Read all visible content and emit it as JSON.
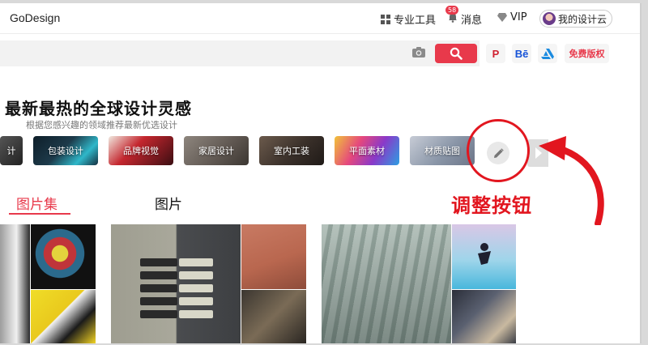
{
  "header": {
    "logo": "GoDesign",
    "tools_label": "专业工具",
    "messages_label": "消息",
    "messages_badge": "58",
    "vip_label": "VIP",
    "cloud_label": "我的设计云"
  },
  "search": {
    "placeholder": "",
    "free_rights_label": "免费版权",
    "brands": [
      "P",
      "Bē",
      "A"
    ]
  },
  "headline": {
    "title": "最新最热的全球设计灵感",
    "subtitle": "根据您感兴趣的领域推荐最新优选设计"
  },
  "categories": [
    {
      "label": "计",
      "color": "#3b3b3b"
    },
    {
      "label": "包装设计",
      "color": "#1d3a4a"
    },
    {
      "label": "品牌视觉",
      "color": "#5b1a1a"
    },
    {
      "label": "家居设计",
      "color": "#6f6760"
    },
    {
      "label": "室内工装",
      "color": "#4a3e36"
    },
    {
      "label": "平面素材",
      "color": "#c0398a"
    },
    {
      "label": "材质贴图",
      "color": "#8a96a8"
    }
  ],
  "annotation": {
    "text": "调整按钮",
    "color": "#e2161f"
  },
  "tabs": [
    {
      "label": "图片集",
      "active": true
    },
    {
      "label": "图片",
      "active": false
    }
  ],
  "colors": {
    "accent": "#e8394b"
  }
}
